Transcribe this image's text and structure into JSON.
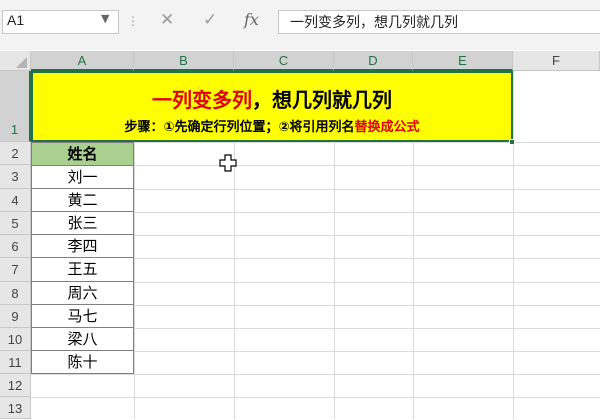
{
  "formula_bar": {
    "name_box": "A1",
    "fx_label": "fx",
    "formula": "一列变多列，想几列就几列"
  },
  "columns": [
    "A",
    "B",
    "C",
    "D",
    "E",
    "F"
  ],
  "rows": [
    "1",
    "2",
    "3",
    "4",
    "5",
    "6",
    "7",
    "8",
    "9",
    "10",
    "11",
    "12",
    "13"
  ],
  "title_cell": {
    "title_red": "一列变多列",
    "title_black": "，想几列就几列",
    "subtitle_black": "步骤：①先确定行列位置；②将引用列名",
    "subtitle_red": "替换成公式"
  },
  "table": {
    "header": "姓名",
    "names": [
      "刘一",
      "黄二",
      "张三",
      "李四",
      "王五",
      "周六",
      "马七",
      "梁八",
      "陈十"
    ]
  },
  "colors": {
    "title_fill": "#ffff00",
    "header_fill": "#a9d08e",
    "accent_red": "#e00000",
    "selection_green": "#217346"
  },
  "icons": [
    "cancel-icon",
    "enter-icon",
    "fx-icon",
    "dropdown-arrow-icon",
    "cross-cursor-icon"
  ]
}
